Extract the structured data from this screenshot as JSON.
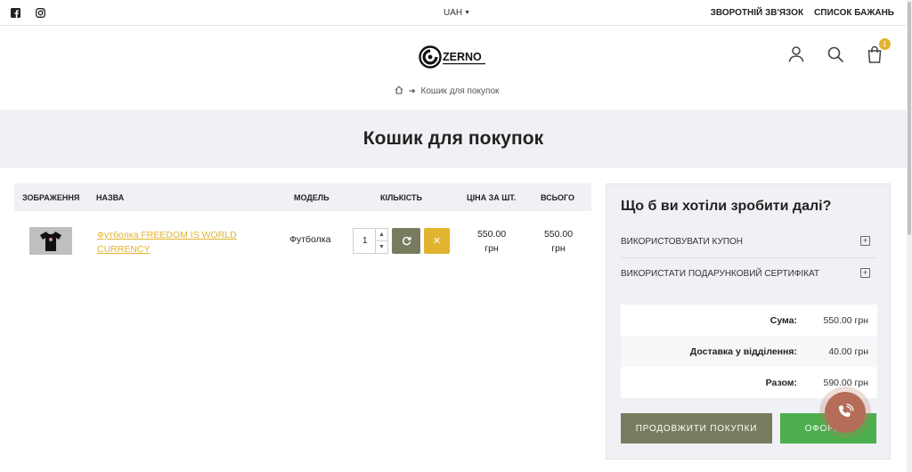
{
  "topbar": {
    "icons": [
      "facebook-icon",
      "instagram-icon"
    ],
    "currency": "UAH",
    "links": [
      "ЗВОРОТНІЙ ЗВ'ЯЗОК",
      "СПИСОК БАЖАНЬ"
    ]
  },
  "header": {
    "logo_text": "ZERNO",
    "cart_count": "1",
    "icons": [
      "user-icon",
      "search-icon",
      "shopping-bag-icon"
    ]
  },
  "breadcrumb": {
    "current": "Кошик для покупок"
  },
  "page": {
    "title": "Кошик для покупок"
  },
  "cart": {
    "headers": {
      "image": "ЗОБРАЖЕННЯ",
      "name": "НАЗВА",
      "model": "МОДЕЛЬ",
      "quantity": "КІЛЬКІСТЬ",
      "unit_price": "ЦІНА ЗА ШТ.",
      "total": "ВСЬОГО"
    },
    "items": [
      {
        "name": "Футболка FREEDOM IS WORLD CURRENCY",
        "model": "Футболка",
        "quantity": "1",
        "unit_price_amount": "550.00",
        "unit_price_currency": "грн",
        "total_amount": "550.00",
        "total_currency": "грн"
      }
    ]
  },
  "panel": {
    "title": "Що б ви хотіли зробити далі?",
    "coupon_label": "ВИКОРИСТОВУВАТИ КУПОН",
    "gift_label": "ВИКОРИСТАТИ ПОДАРУНКОВИЙ СЕРТИФІКАТ",
    "totals": [
      {
        "label": "Сума:",
        "value": "550.00 грн"
      },
      {
        "label": "Доставка у відділення:",
        "value": "40.00 грн"
      },
      {
        "label": "Разом:",
        "value": "590.00 грн"
      }
    ],
    "continue_label": "ПРОДОВЖИТИ ПОКУПКИ",
    "checkout_label": "ОФОРМ..."
  },
  "colors": {
    "accent_yellow": "#e1b32f",
    "olive": "#787b5e",
    "green": "#4cae4c",
    "call_button": "#b56d59",
    "band_gray": "#eff1f4"
  }
}
